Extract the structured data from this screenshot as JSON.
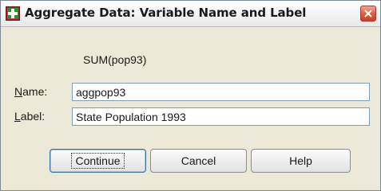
{
  "window": {
    "title": "Aggregate Data: Variable Name and Label",
    "app_icon": "spss-dialog-icon",
    "close_icon": "close-icon"
  },
  "function_label": "SUM(pop93)",
  "fields": {
    "name": {
      "label_mnemonic": "N",
      "label_rest": "ame:",
      "value": "aggpop93"
    },
    "label": {
      "label_mnemonic": "L",
      "label_rest": "abel:",
      "value": "State Population 1993"
    }
  },
  "buttons": {
    "continue": "Continue",
    "cancel": "Cancel",
    "help": "Help"
  }
}
